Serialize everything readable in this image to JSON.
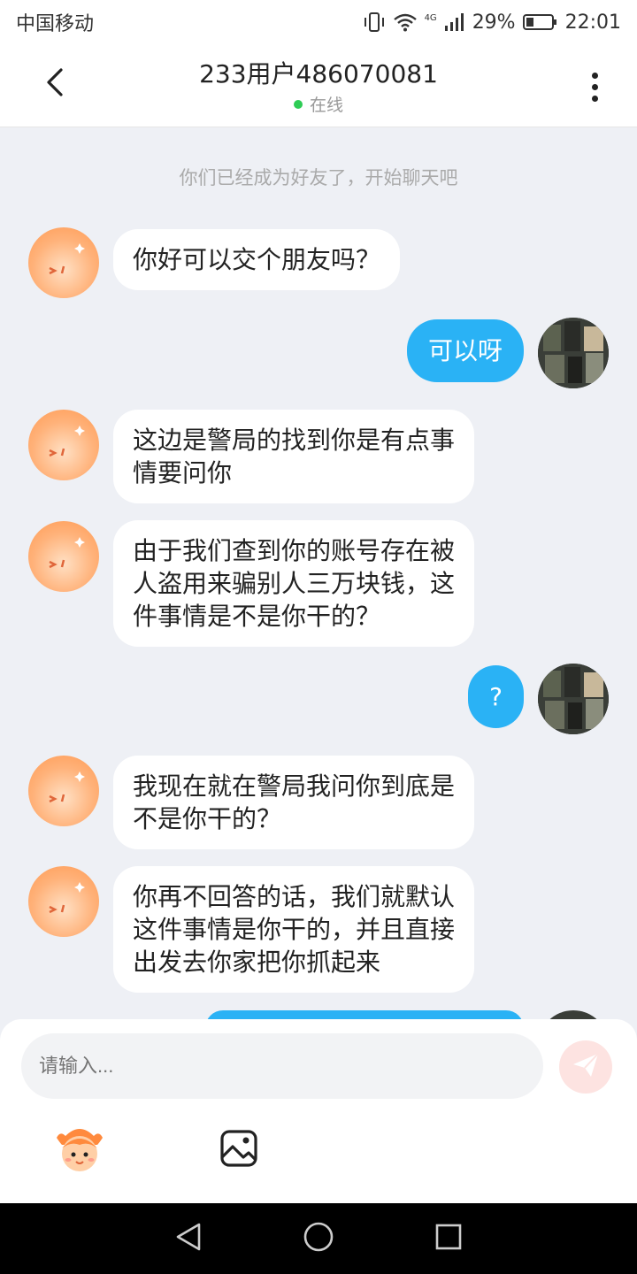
{
  "status_bar": {
    "carrier": "中国移动",
    "network": "4G",
    "battery": "29%",
    "battery_level": 0.29,
    "time": "22:01"
  },
  "header": {
    "title": "233用户486070081",
    "status": "在线"
  },
  "chat": {
    "system_note": "你们已经成为好友了，开始聊天吧",
    "messages": [
      {
        "from": "other",
        "text": "你好可以交个朋友吗？"
      },
      {
        "from": "self",
        "text": "可以呀"
      },
      {
        "from": "other",
        "lines": [
          "这边是警局的找到你是有点事",
          "情要问你"
        ]
      },
      {
        "from": "other",
        "lines": [
          "由于我们查到你的账号存在被",
          "人盗用来骗别人三万块钱，这",
          "件事情是不是你干的？"
        ]
      },
      {
        "from": "self",
        "text": "?"
      },
      {
        "from": "other",
        "lines": [
          "我现在就在警局我问你到底是",
          "不是你干的？"
        ]
      },
      {
        "from": "other",
        "lines": [
          "你再不回答的话，我们就默认",
          "这件事情是你干的，并且直接",
          "出发去你家把你抓起来"
        ]
      }
    ]
  },
  "input": {
    "placeholder": "请输入..."
  },
  "colors": {
    "accent": "#2ab2f5",
    "online": "#2ecc55",
    "send_disabled": "#fde3e1"
  },
  "icons": {
    "back": "chevron-left-icon",
    "more": "more-vertical-icon",
    "send": "paper-plane-icon",
    "emoji": "emoji-face-icon",
    "image": "image-icon",
    "nav_back": "triangle-back-icon",
    "nav_home": "circle-home-icon",
    "nav_recent": "square-recent-icon"
  }
}
